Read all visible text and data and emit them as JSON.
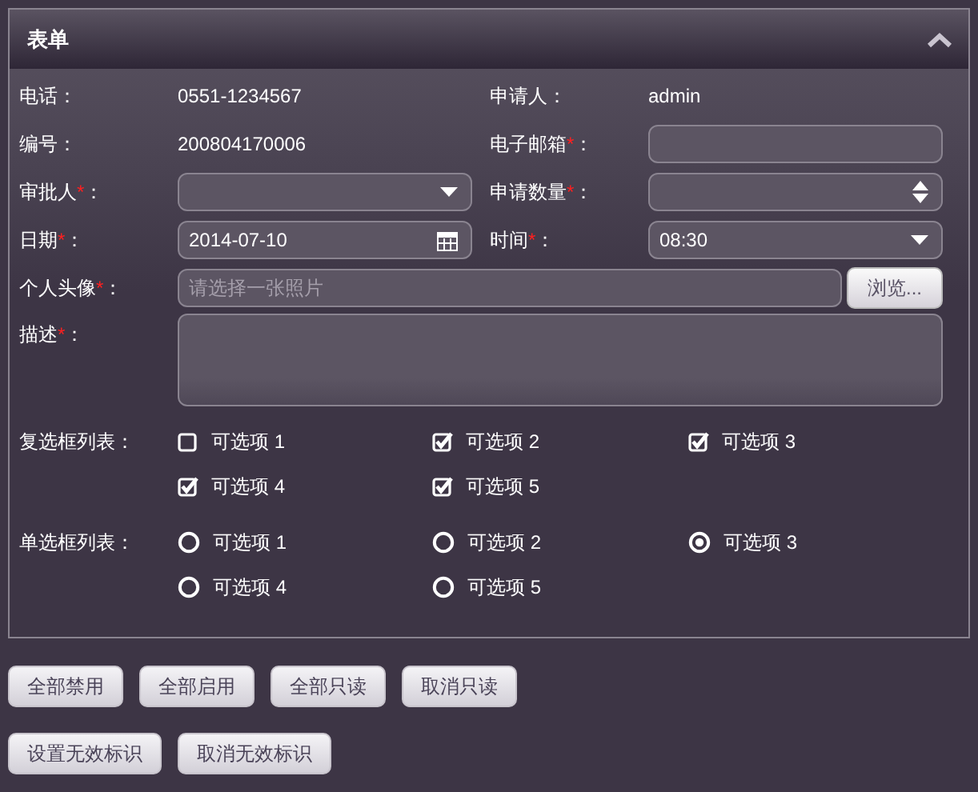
{
  "panel": {
    "title": "表单"
  },
  "info": [
    {
      "label": "电话：",
      "value": "0551-1234567"
    },
    {
      "label": "申请人：",
      "value": "admin"
    },
    {
      "label": "编号：",
      "value": "200804170006"
    },
    {
      "label": "电子邮箱",
      "mark": "*",
      "colon": "：",
      "kind": "text"
    },
    {
      "label": "审批人",
      "mark": "*",
      "colon": "：",
      "kind": "select"
    },
    {
      "label": "申请数量",
      "mark": "*",
      "colon": "：",
      "kind": "spinner"
    },
    {
      "label": "日期",
      "mark": "*",
      "colon": "：",
      "kind": "date",
      "value": "2014-07-10"
    },
    {
      "label": "时间",
      "mark": "*",
      "colon": "：",
      "kind": "select",
      "value": "08:30"
    }
  ],
  "avatar": {
    "label": "个人头像",
    "mark": "*",
    "colon": "：",
    "placeholder": "请选择一张照片",
    "button": "浏览..."
  },
  "description": {
    "label": "描述",
    "mark": "*",
    "colon": "："
  },
  "checkbox_list": {
    "label": "复选框列表：",
    "options": [
      {
        "label": "可选项 1",
        "checked": false
      },
      {
        "label": "可选项 2",
        "checked": true
      },
      {
        "label": "可选项 3",
        "checked": true
      },
      {
        "label": "可选项 4",
        "checked": true
      },
      {
        "label": "可选项 5",
        "checked": true
      }
    ]
  },
  "radio_list": {
    "label": "单选框列表：",
    "options": [
      {
        "label": "可选项 1",
        "selected": false
      },
      {
        "label": "可选项 2",
        "selected": false
      },
      {
        "label": "可选项 3",
        "selected": true
      },
      {
        "label": "可选项 4",
        "selected": false
      },
      {
        "label": "可选项 5",
        "selected": false
      }
    ]
  },
  "button_rows": [
    [
      "全部禁用",
      "全部启用",
      "全部只读",
      "取消只读"
    ],
    [
      "设置无效标识",
      "取消无效标识"
    ]
  ]
}
